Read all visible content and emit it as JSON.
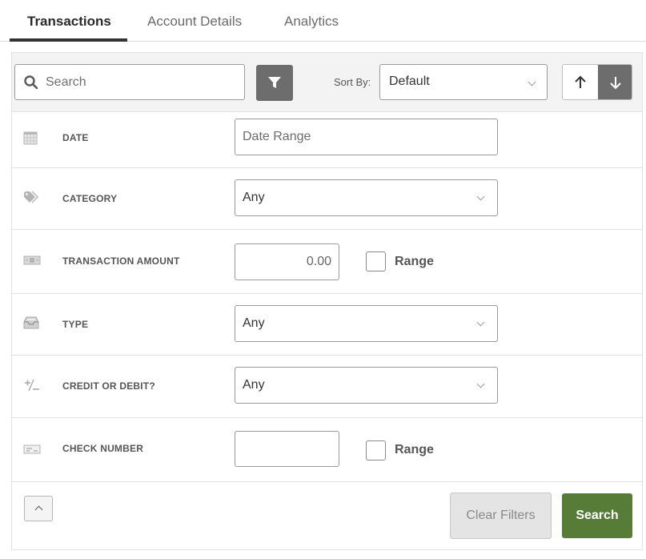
{
  "tabs": [
    {
      "label": "Transactions",
      "active": true
    },
    {
      "label": "Account Details",
      "active": false
    },
    {
      "label": "Analytics",
      "active": false
    }
  ],
  "toolbar": {
    "search_placeholder": "Search",
    "sort_label": "Sort By:",
    "sort_value": "Default",
    "filter_icon": "filter-icon",
    "sort_asc_icon": "arrow-up-icon",
    "sort_desc_icon": "arrow-down-icon"
  },
  "filters": {
    "date": {
      "label": "DATE",
      "icon": "calendar-icon",
      "placeholder": "Date Range"
    },
    "category": {
      "label": "CATEGORY",
      "icon": "tag-icon",
      "value": "Any"
    },
    "amount": {
      "label": "TRANSACTION AMOUNT",
      "icon": "money-icon",
      "value": "0.00",
      "range_label": "Range"
    },
    "type": {
      "label": "TYPE",
      "icon": "inbox-icon",
      "value": "Any"
    },
    "credit_debit": {
      "label": "CREDIT OR DEBIT?",
      "icon": "plus-minus-icon",
      "value": "Any"
    },
    "check_number": {
      "label": "CHECK NUMBER",
      "icon": "check-icon",
      "value": "",
      "range_label": "Range"
    }
  },
  "actions": {
    "clear_label": "Clear Filters",
    "search_label": "Search"
  },
  "colors": {
    "primary_green": "#577c38",
    "dark_gray": "#6d6d6d",
    "toolbar_bg": "#f3f3f3"
  }
}
